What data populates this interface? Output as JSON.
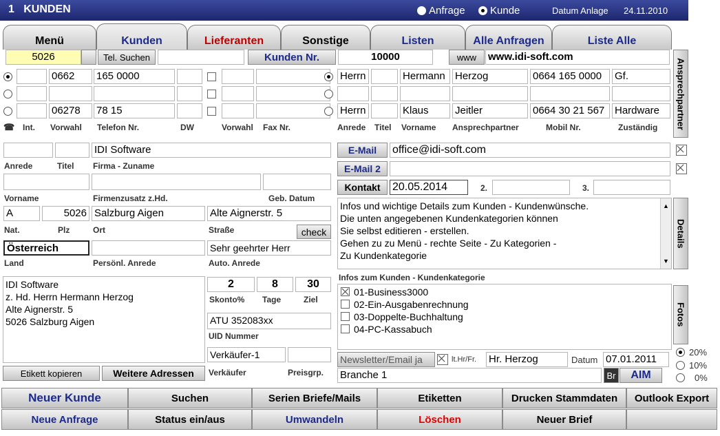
{
  "title": "1   KUNDEN",
  "radio_anfrage": "Anfrage",
  "radio_kunde": "Kunde",
  "datum_anlage_label": "Datum Anlage",
  "datum_anlage": "24.11.2010",
  "tabs": [
    "Menü",
    "Kunden",
    "Lieferanten",
    "Sonstige",
    "Listen",
    "Alle Anfragen",
    "Liste Alle"
  ],
  "row2": {
    "kunde_id": "5026",
    "tel_suchen": "Tel. Suchen",
    "kunden_nr_label": "Kunden Nr.",
    "kunden_nr": "10000",
    "www_btn": "www",
    "www": "www.idi-soft.com"
  },
  "phones": [
    {
      "vorwahl": "0662",
      "telefon": "165 0000",
      "dw": "",
      "fvorwahl": "",
      "fax": ""
    },
    {
      "vorwahl": "",
      "telefon": "",
      "dw": "",
      "fvorwahl": "",
      "fax": ""
    },
    {
      "vorwahl": "06278",
      "telefon": "78 15",
      "dw": "",
      "fvorwahl": "",
      "fax": ""
    }
  ],
  "phone_labels": {
    "int": "Int.",
    "vorwahl": "Vorwahl",
    "telefon": "Telefon Nr.",
    "dw": "DW",
    "fvorwahl": "Vorwahl",
    "fax": "Fax Nr."
  },
  "contacts": [
    {
      "anrede": "Herrn",
      "titel": "",
      "vorname": "Hermann",
      "name": "Herzog",
      "mobil": "0664 165 0000",
      "zust": "Gf."
    },
    {
      "anrede": "",
      "titel": "",
      "vorname": "",
      "name": "",
      "mobil": "",
      "zust": ""
    },
    {
      "anrede": "Herrn",
      "titel": "",
      "vorname": "Klaus",
      "name": "Jeitler",
      "mobil": "0664 30 21 567",
      "zust": "Hardware"
    }
  ],
  "contact_labels": {
    "anrede": "Anrede",
    "titel": "Titel",
    "vorname": "Vorname",
    "name": "Ansprechpartner",
    "mobil": "Mobil Nr.",
    "zust": "Zuständig"
  },
  "ansprechpartner_btn": "Ansprechpartner",
  "left": {
    "anrede": "",
    "titel": "",
    "firma": "IDI Software",
    "lbl_anrede": "Anrede",
    "lbl_titel": "Titel",
    "lbl_firma": "Firma - Zuname",
    "vorname": "",
    "zusatz": "",
    "geb": "",
    "lbl_vorname": "Vorname",
    "lbl_zusatz": "Firmenzusatz z.Hd.",
    "lbl_geb": "Geb. Datum",
    "nat": "A",
    "plz": "5026",
    "ort": "Salzburg Aigen",
    "strasse": "Alte Aignerstr. 5",
    "lbl_nat": "Nat.",
    "lbl_plz": "Plz",
    "lbl_ort": "Ort",
    "lbl_strasse": "Straße",
    "check": "check",
    "land": "Österreich",
    "pers_anrede": "",
    "auto_anrede": "Sehr geehrter Herr",
    "lbl_land": "Land",
    "lbl_pers": "Persönl. Anrede",
    "lbl_auto": "Auto.  Anrede",
    "address_lines": [
      "IDI Software",
      "z. Hd. Herrn Hermann Herzog",
      "Alte Aignerstr. 5",
      "5026 Salzburg Aigen"
    ],
    "skonto": "2",
    "tage": "8",
    "ziel": "30",
    "lbl_skonto": "Skonto%",
    "lbl_tage": "Tage",
    "lbl_ziel": "Ziel",
    "uid": "ATU 352083xx",
    "lbl_uid": "UID Nummer",
    "verkaeufer": "Verkäufer-1",
    "preisgrp": "",
    "lbl_verk": "Verkäufer",
    "lbl_preis": "Preisgrp.",
    "etikett_btn": "Etikett kopieren",
    "weitere_btn": "Weitere Adressen"
  },
  "right": {
    "email_btn": "E-Mail",
    "email": "office@idi-soft.com",
    "email2_btn": "E-Mail 2",
    "email2": "",
    "kontakt_btn": "Kontakt",
    "kontakt": "20.05.2014",
    "k2_lbl": "2.",
    "k2": "",
    "k3_lbl": "3.",
    "k3": "",
    "info_lines": [
      "Infos und wichtige Details zum Kunden - Kundenwünsche.",
      "Die unten angegebenen Kundenkategorien können",
      "Sie selbst editieren - erstellen.",
      "Gehen zu zu Menü - rechte Seite - Zu Kategorien -",
      "Zu Kundenkategorie"
    ],
    "details_btn": "Details",
    "kat_label": "Infos zum Kunden - Kundenkategorie",
    "kategorien": [
      {
        "label": "01-Business3000",
        "checked": true
      },
      {
        "label": "02-Ein-Ausgabenrechnung",
        "checked": false
      },
      {
        "label": "03-Doppelte-Buchhaltung",
        "checked": false
      },
      {
        "label": "04-PC-Kassabuch",
        "checked": false
      }
    ],
    "fotos_btn": "Fotos",
    "newsletter": "Newsletter/Email ja",
    "lthr": "lt.Hr/Fr.",
    "lthr_val": "Hr. Herzog",
    "datum_lbl": "Datum",
    "datum": "07.01.2011",
    "branche": "Branche 1",
    "br": "Br",
    "aim": "AIM",
    "pct": [
      "20%",
      "10%",
      "0%"
    ]
  },
  "bottom1": [
    "Neuer Kunde",
    "Suchen",
    "Serien Briefe/Mails",
    "Etiketten",
    "Drucken Stammdaten",
    "Outlook Export"
  ],
  "bottom2": [
    "Neue Anfrage",
    "Status ein/aus",
    "Umwandeln",
    "Löschen",
    "Neuer Brief",
    ""
  ]
}
